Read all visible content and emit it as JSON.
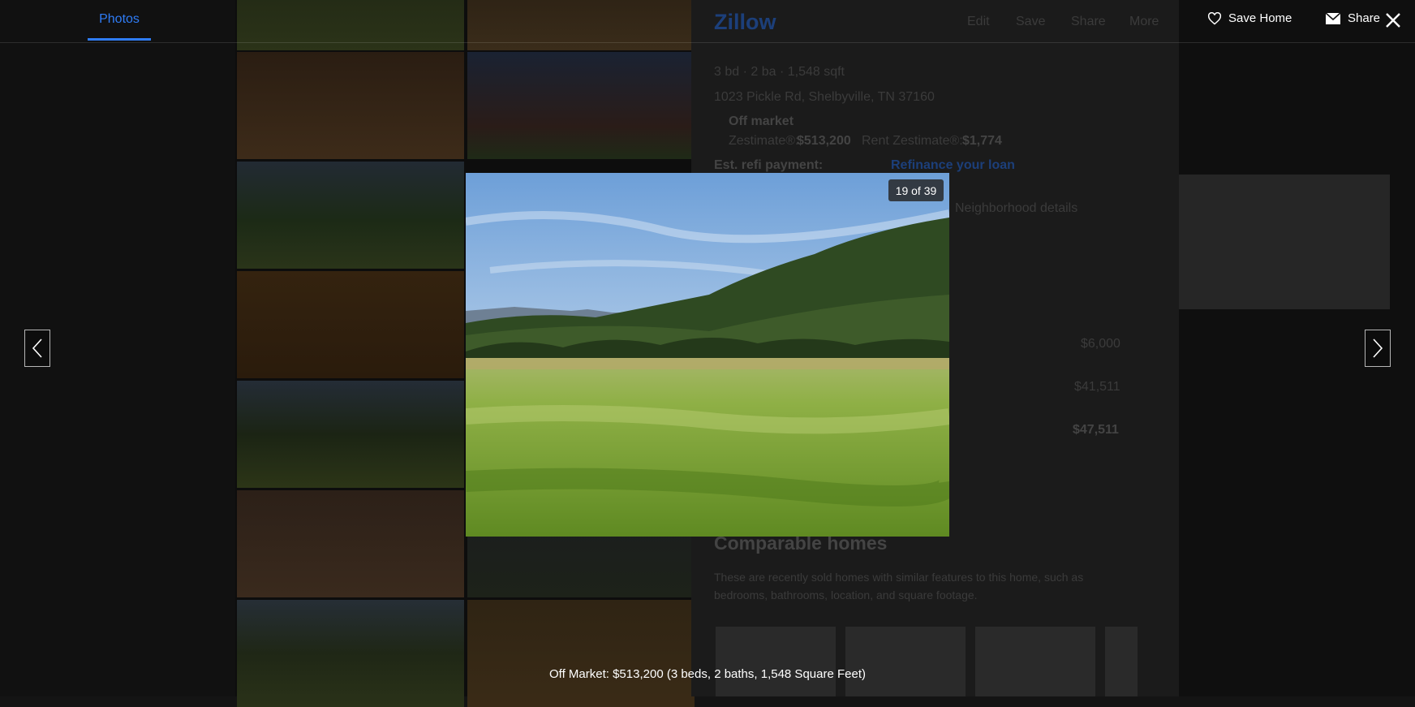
{
  "overlay": {
    "tab_photos": "Photos",
    "save_home": "Save Home",
    "share": "Share",
    "counter": "19 of 39",
    "caption": "Off Market: $513,200 (3 beds, 2 baths, 1,548 Square Feet)"
  },
  "background_page": {
    "logo": "Zillow",
    "actions": [
      "Edit",
      "Save",
      "Share",
      "More"
    ],
    "facts": "3 bd  ·  2 ba  ·  1,548 sqft",
    "address": "1023 Pickle Rd, Shelbyville, TN 37160",
    "status": "Off market",
    "zestimate_label": "Zestimate®:",
    "zestimate_value": "$513,200",
    "rent_label": "Rent Zestimate®:",
    "rent_value": "$1,774",
    "refi_label": "Est. refi payment:",
    "refi_link": "Refinance your loan",
    "neighborhood": "Neighborhood details",
    "values": [
      "$6,000",
      "$41,511",
      "$47,511"
    ],
    "comparable_title": "Comparable homes",
    "comparable_desc": "These are recently sold homes with similar features to this home, such as bedrooms, bathrooms, location, and square footage."
  },
  "colors": {
    "accent": "#2f7cf6",
    "overlay_bg": "#141414"
  },
  "icons": {
    "save": "heart-icon",
    "share": "envelope-icon",
    "close": "close-icon",
    "prev": "chevron-left-icon",
    "next": "chevron-right-icon"
  }
}
